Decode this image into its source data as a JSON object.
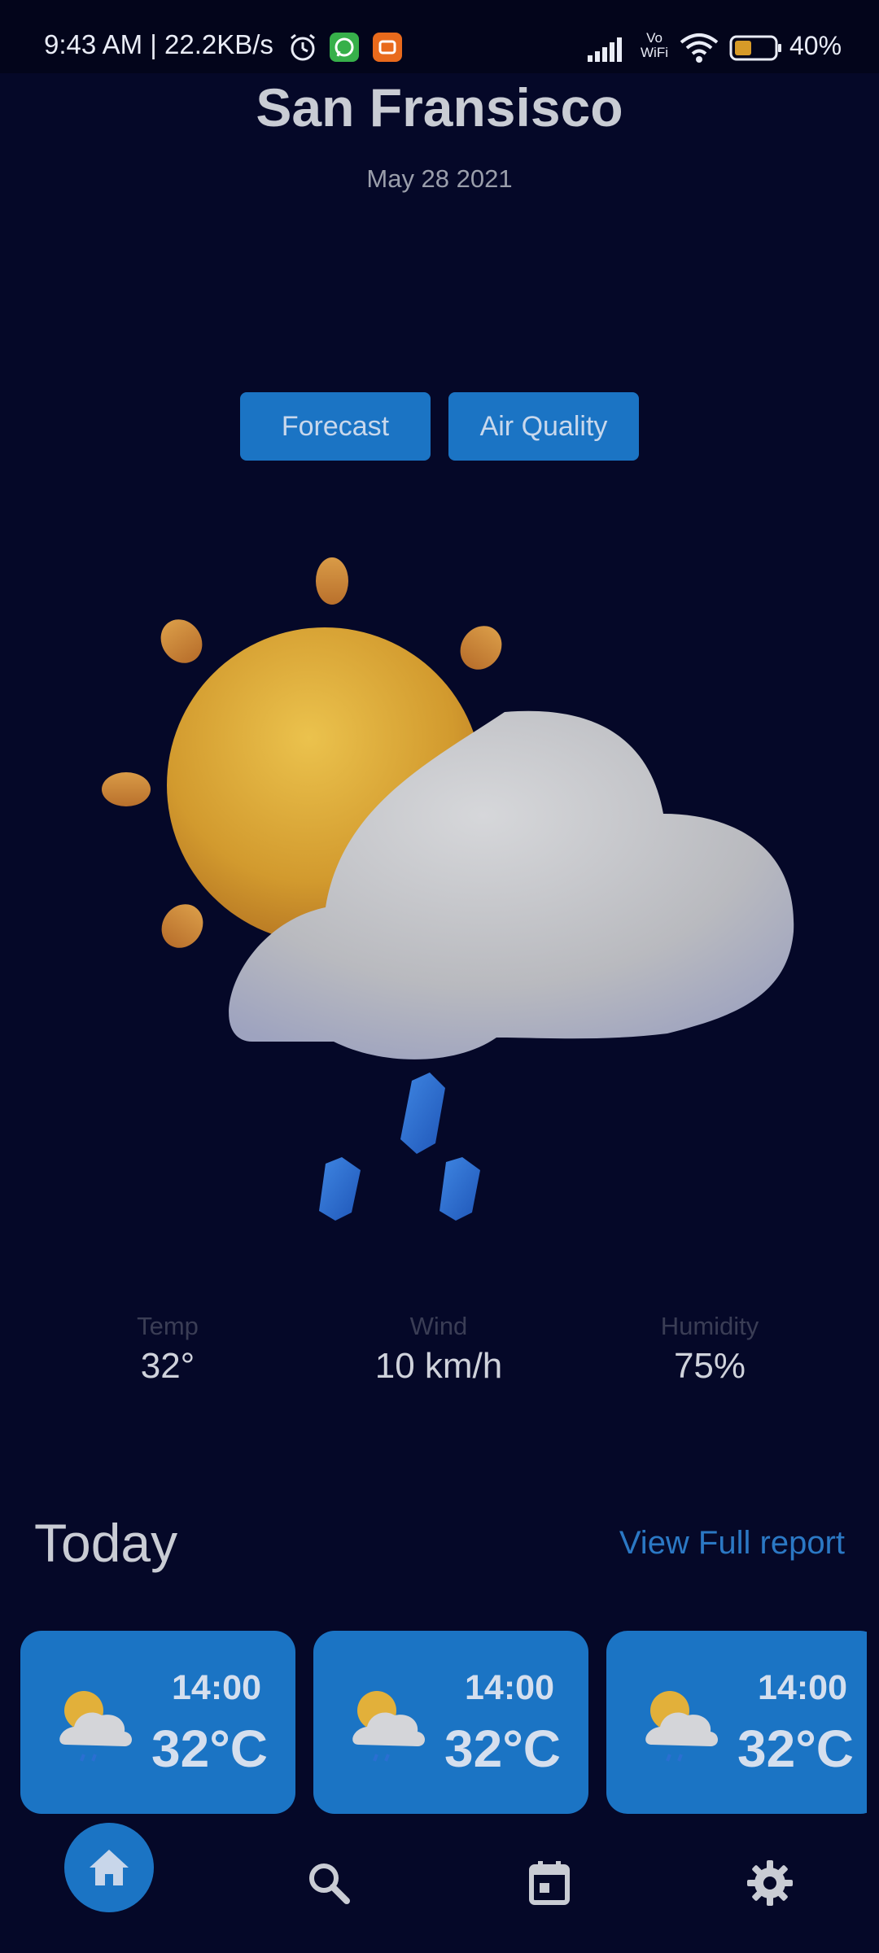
{
  "status_bar": {
    "time_speed": "9:43 AM | 22.2KB/s",
    "battery_percent": "40%",
    "wifi_label_top": "Vo",
    "wifi_label_bottom": "WiFi"
  },
  "header": {
    "city": "San Fransisco",
    "date": "May 28 2021"
  },
  "buttons": {
    "forecast": "Forecast",
    "air_quality": "Air Quality"
  },
  "metrics": [
    {
      "label": "Temp",
      "value": "32°"
    },
    {
      "label": "Wind",
      "value": "10 km/h"
    },
    {
      "label": "Humidity",
      "value": "75%"
    }
  ],
  "today": {
    "title": "Today",
    "view_report": "View Full report",
    "cards": [
      {
        "time": "14:00",
        "temp": "32°C"
      },
      {
        "time": "14:00",
        "temp": "32°C"
      },
      {
        "time": "14:00",
        "temp": "32°C"
      }
    ]
  },
  "icons": {
    "weather": "sun-cloud-rain-icon",
    "home": "home-icon",
    "search": "search-icon",
    "calendar": "calendar-icon",
    "settings": "gear-icon"
  },
  "colors": {
    "background": "#050828",
    "accent": "#1b74c4",
    "link": "#2b78c4",
    "sun": "#e2b03a",
    "cloud": "#c7c8cc",
    "rain": "#2a6fd1"
  }
}
